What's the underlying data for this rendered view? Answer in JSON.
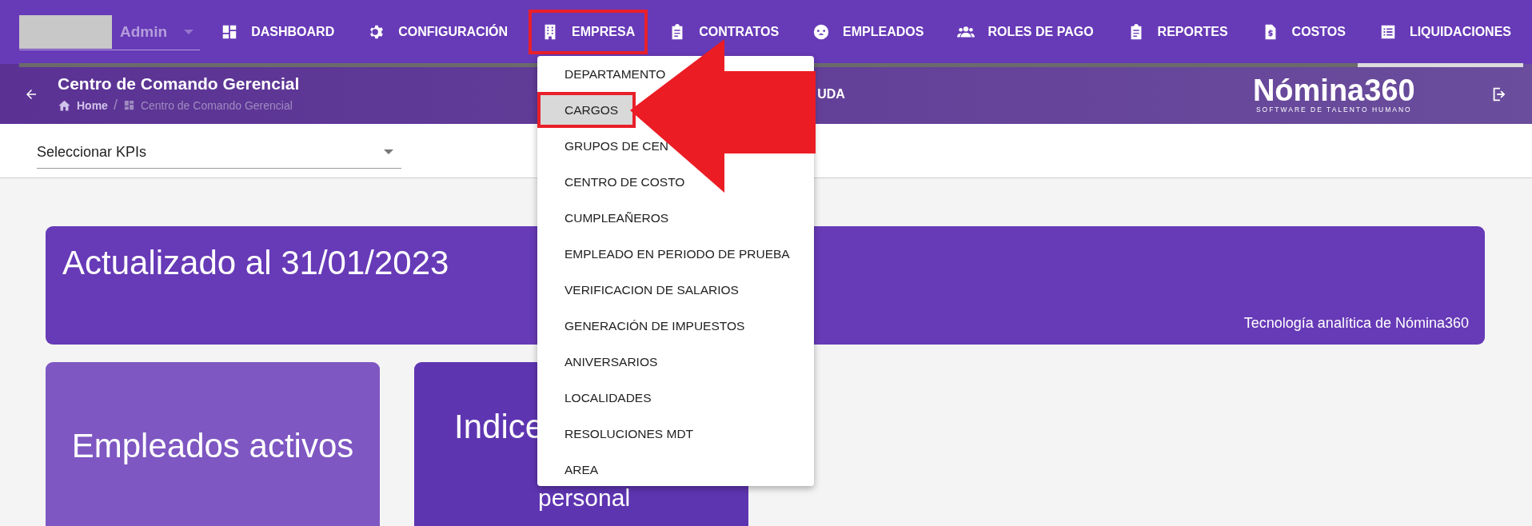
{
  "user_menu": {
    "value": "Admin"
  },
  "nav": [
    {
      "label": "DASHBOARD",
      "highlighted": false
    },
    {
      "label": "CONFIGURACIÓN",
      "highlighted": false
    },
    {
      "label": "EMPRESA",
      "highlighted": true
    },
    {
      "label": "CONTRATOS",
      "highlighted": false
    },
    {
      "label": "EMPLEADOS",
      "highlighted": false
    },
    {
      "label": "ROLES DE PAGO",
      "highlighted": false
    },
    {
      "label": "REPORTES",
      "highlighted": false
    },
    {
      "label": "COSTOS",
      "highlighted": false
    },
    {
      "label": "LIQUIDACIONES",
      "highlighted": false
    }
  ],
  "loading_bar": {
    "level": 0.89
  },
  "header": {
    "title": "Centro de Comando Gerencial",
    "breadcrumb": [
      "Home",
      "/",
      "Centro de Comando Gerencial"
    ],
    "partial_link": "UDA",
    "logo": "Nómina360",
    "logo_tagline": "SOFTWARE DE TALENTO HUMANO"
  },
  "kpi_select": {
    "placeholder": "Seleccionar KPIs"
  },
  "banner": {
    "title": "Actualizado al 31/01/2023",
    "footer": "Tecnología analítica de Nómina360"
  },
  "cards": [
    {
      "lines": [
        "Empleados activos"
      ]
    },
    {
      "lines": [
        "Indice",
        "personal"
      ]
    }
  ],
  "dropdown": [
    {
      "label": "DEPARTAMENTO",
      "selected": false,
      "highlighted": false
    },
    {
      "label": "CARGOS",
      "selected": true,
      "highlighted": true
    },
    {
      "label": "GRUPOS DE CEN",
      "selected": false,
      "highlighted": false
    },
    {
      "label": "CENTRO DE COSTO",
      "selected": false,
      "highlighted": false
    },
    {
      "label": "CUMPLEAÑEROS",
      "selected": false,
      "highlighted": false
    },
    {
      "label": "EMPLEADO EN PERIODO DE PRUEBA",
      "selected": false,
      "highlighted": false
    },
    {
      "label": "VERIFICACION DE SALARIOS",
      "selected": false,
      "highlighted": false
    },
    {
      "label": "GENERACIÓN DE IMPUESTOS",
      "selected": false,
      "highlighted": false
    },
    {
      "label": "ANIVERSARIOS",
      "selected": false,
      "highlighted": false
    },
    {
      "label": "LOCALIDADES",
      "selected": false,
      "highlighted": false
    },
    {
      "label": "RESOLUCIONES MDT",
      "selected": false,
      "highlighted": false
    },
    {
      "label": "AREA",
      "selected": false,
      "highlighted": false
    }
  ]
}
